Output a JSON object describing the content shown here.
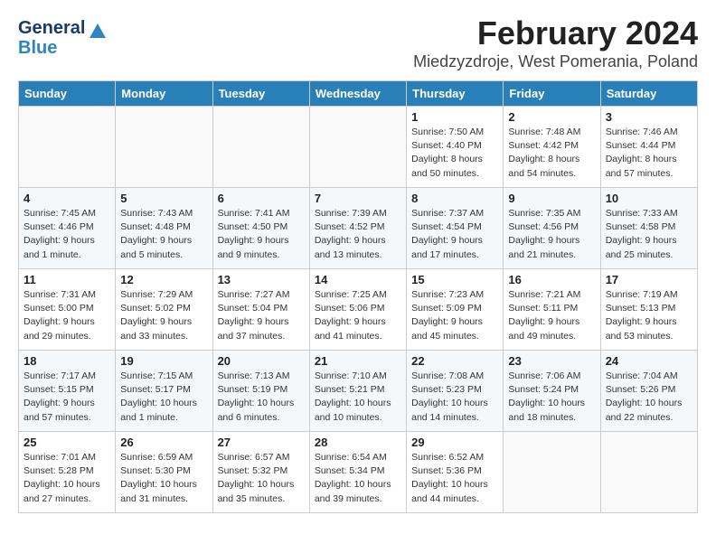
{
  "logo": {
    "line1": "General",
    "line2": "Blue"
  },
  "title": "February 2024",
  "location": "Miedzyzdroje, West Pomerania, Poland",
  "days_of_week": [
    "Sunday",
    "Monday",
    "Tuesday",
    "Wednesday",
    "Thursday",
    "Friday",
    "Saturday"
  ],
  "weeks": [
    [
      {
        "day": "",
        "info": ""
      },
      {
        "day": "",
        "info": ""
      },
      {
        "day": "",
        "info": ""
      },
      {
        "day": "",
        "info": ""
      },
      {
        "day": "1",
        "info": "Sunrise: 7:50 AM\nSunset: 4:40 PM\nDaylight: 8 hours\nand 50 minutes."
      },
      {
        "day": "2",
        "info": "Sunrise: 7:48 AM\nSunset: 4:42 PM\nDaylight: 8 hours\nand 54 minutes."
      },
      {
        "day": "3",
        "info": "Sunrise: 7:46 AM\nSunset: 4:44 PM\nDaylight: 8 hours\nand 57 minutes."
      }
    ],
    [
      {
        "day": "4",
        "info": "Sunrise: 7:45 AM\nSunset: 4:46 PM\nDaylight: 9 hours\nand 1 minute."
      },
      {
        "day": "5",
        "info": "Sunrise: 7:43 AM\nSunset: 4:48 PM\nDaylight: 9 hours\nand 5 minutes."
      },
      {
        "day": "6",
        "info": "Sunrise: 7:41 AM\nSunset: 4:50 PM\nDaylight: 9 hours\nand 9 minutes."
      },
      {
        "day": "7",
        "info": "Sunrise: 7:39 AM\nSunset: 4:52 PM\nDaylight: 9 hours\nand 13 minutes."
      },
      {
        "day": "8",
        "info": "Sunrise: 7:37 AM\nSunset: 4:54 PM\nDaylight: 9 hours\nand 17 minutes."
      },
      {
        "day": "9",
        "info": "Sunrise: 7:35 AM\nSunset: 4:56 PM\nDaylight: 9 hours\nand 21 minutes."
      },
      {
        "day": "10",
        "info": "Sunrise: 7:33 AM\nSunset: 4:58 PM\nDaylight: 9 hours\nand 25 minutes."
      }
    ],
    [
      {
        "day": "11",
        "info": "Sunrise: 7:31 AM\nSunset: 5:00 PM\nDaylight: 9 hours\nand 29 minutes."
      },
      {
        "day": "12",
        "info": "Sunrise: 7:29 AM\nSunset: 5:02 PM\nDaylight: 9 hours\nand 33 minutes."
      },
      {
        "day": "13",
        "info": "Sunrise: 7:27 AM\nSunset: 5:04 PM\nDaylight: 9 hours\nand 37 minutes."
      },
      {
        "day": "14",
        "info": "Sunrise: 7:25 AM\nSunset: 5:06 PM\nDaylight: 9 hours\nand 41 minutes."
      },
      {
        "day": "15",
        "info": "Sunrise: 7:23 AM\nSunset: 5:09 PM\nDaylight: 9 hours\nand 45 minutes."
      },
      {
        "day": "16",
        "info": "Sunrise: 7:21 AM\nSunset: 5:11 PM\nDaylight: 9 hours\nand 49 minutes."
      },
      {
        "day": "17",
        "info": "Sunrise: 7:19 AM\nSunset: 5:13 PM\nDaylight: 9 hours\nand 53 minutes."
      }
    ],
    [
      {
        "day": "18",
        "info": "Sunrise: 7:17 AM\nSunset: 5:15 PM\nDaylight: 9 hours\nand 57 minutes."
      },
      {
        "day": "19",
        "info": "Sunrise: 7:15 AM\nSunset: 5:17 PM\nDaylight: 10 hours\nand 1 minute."
      },
      {
        "day": "20",
        "info": "Sunrise: 7:13 AM\nSunset: 5:19 PM\nDaylight: 10 hours\nand 6 minutes."
      },
      {
        "day": "21",
        "info": "Sunrise: 7:10 AM\nSunset: 5:21 PM\nDaylight: 10 hours\nand 10 minutes."
      },
      {
        "day": "22",
        "info": "Sunrise: 7:08 AM\nSunset: 5:23 PM\nDaylight: 10 hours\nand 14 minutes."
      },
      {
        "day": "23",
        "info": "Sunrise: 7:06 AM\nSunset: 5:24 PM\nDaylight: 10 hours\nand 18 minutes."
      },
      {
        "day": "24",
        "info": "Sunrise: 7:04 AM\nSunset: 5:26 PM\nDaylight: 10 hours\nand 22 minutes."
      }
    ],
    [
      {
        "day": "25",
        "info": "Sunrise: 7:01 AM\nSunset: 5:28 PM\nDaylight: 10 hours\nand 27 minutes."
      },
      {
        "day": "26",
        "info": "Sunrise: 6:59 AM\nSunset: 5:30 PM\nDaylight: 10 hours\nand 31 minutes."
      },
      {
        "day": "27",
        "info": "Sunrise: 6:57 AM\nSunset: 5:32 PM\nDaylight: 10 hours\nand 35 minutes."
      },
      {
        "day": "28",
        "info": "Sunrise: 6:54 AM\nSunset: 5:34 PM\nDaylight: 10 hours\nand 39 minutes."
      },
      {
        "day": "29",
        "info": "Sunrise: 6:52 AM\nSunset: 5:36 PM\nDaylight: 10 hours\nand 44 minutes."
      },
      {
        "day": "",
        "info": ""
      },
      {
        "day": "",
        "info": ""
      }
    ]
  ]
}
